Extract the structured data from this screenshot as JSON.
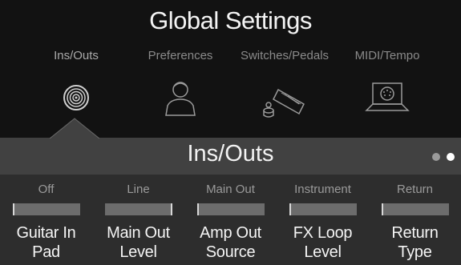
{
  "title": "Global Settings",
  "tabs": [
    {
      "label": "Ins/Outs",
      "icon": "io-jack-icon",
      "active": true
    },
    {
      "label": "Preferences",
      "icon": "user-icon",
      "active": false
    },
    {
      "label": "Switches/Pedals",
      "icon": "pedal-icon",
      "active": false
    },
    {
      "label": "MIDI/Tempo",
      "icon": "midi-laptop-icon",
      "active": false
    }
  ],
  "panel": {
    "title": "Ins/Outs",
    "page_count": 2,
    "current_page": 2
  },
  "controls": [
    {
      "value": "Off",
      "name_line1": "Guitar In",
      "name_line2": "Pad"
    },
    {
      "value": "Line",
      "name_line1": "Main Out",
      "name_line2": "Level"
    },
    {
      "value": "Main Out",
      "name_line1": "Amp Out",
      "name_line2": "Source"
    },
    {
      "value": "Instrument",
      "name_line1": "FX Loop",
      "name_line2": "Level"
    },
    {
      "value": "Return",
      "name_line1": "Return",
      "name_line2": "Type"
    }
  ]
}
